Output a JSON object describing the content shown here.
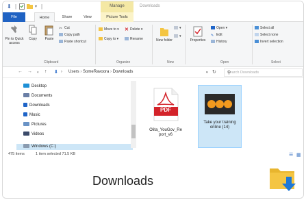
{
  "title_bar": {
    "manage_tab": "Manage",
    "window_title": "Downloads"
  },
  "ribbon_tabs": [
    "File",
    "Home",
    "Share",
    "View",
    "Picture Tools"
  ],
  "ribbon": {
    "pin_label": "Pin to Quick access",
    "copy_label": "Copy",
    "paste_label": "Paste",
    "cut_label": "Cut",
    "copy_path_label": "Copy path",
    "paste_shortcut_label": "Paste shortcut",
    "clipboard_group": "Clipboard",
    "move_to_label": "Move to",
    "copy_to_label": "Copy to",
    "delete_label": "Delete",
    "rename_label": "Rename",
    "organize_group": "Organize",
    "new_folder_label": "New folder",
    "new_group": "New",
    "properties_label": "Properties",
    "open_label": "Open",
    "edit_label": "Edit",
    "history_label": "History",
    "open_group": "Open",
    "select_all_label": "Select all",
    "select_none_label": "Select none",
    "invert_selection_label": "Invert selection",
    "select_group": "Select"
  },
  "address": {
    "path": [
      "Users",
      "SomeRavoora",
      "Downloads"
    ],
    "search_placeholder": "Search Downloads"
  },
  "nav_pane": [
    {
      "label": "Desktop",
      "color": "#1e90d6"
    },
    {
      "label": "Documents",
      "color": "#6a7fa6"
    },
    {
      "label": "Downloads",
      "color": "#1e64c8"
    },
    {
      "label": "Music",
      "color": "#1e64c8"
    },
    {
      "label": "Pictures",
      "color": "#6a93c6"
    },
    {
      "label": "Videos",
      "color": "#3b4a6a"
    },
    {
      "label": "Windows (C:)",
      "color": "#8a9bb0"
    }
  ],
  "files": [
    {
      "name": "Olita_YouGov_Re port_v6",
      "icon": "pdf-icon",
      "badge": "PDF"
    },
    {
      "name": "Take your training online (14)",
      "icon": "image-thumbnail"
    }
  ],
  "status": {
    "item_count": "475 items",
    "selection": "1 item selected  71.5 KB"
  },
  "caption": "Downloads",
  "colors": {
    "accent": "#1f62c3",
    "selection": "#cde6f7",
    "manage_tab": "#f4e8a4",
    "folder": "#f4c542"
  }
}
